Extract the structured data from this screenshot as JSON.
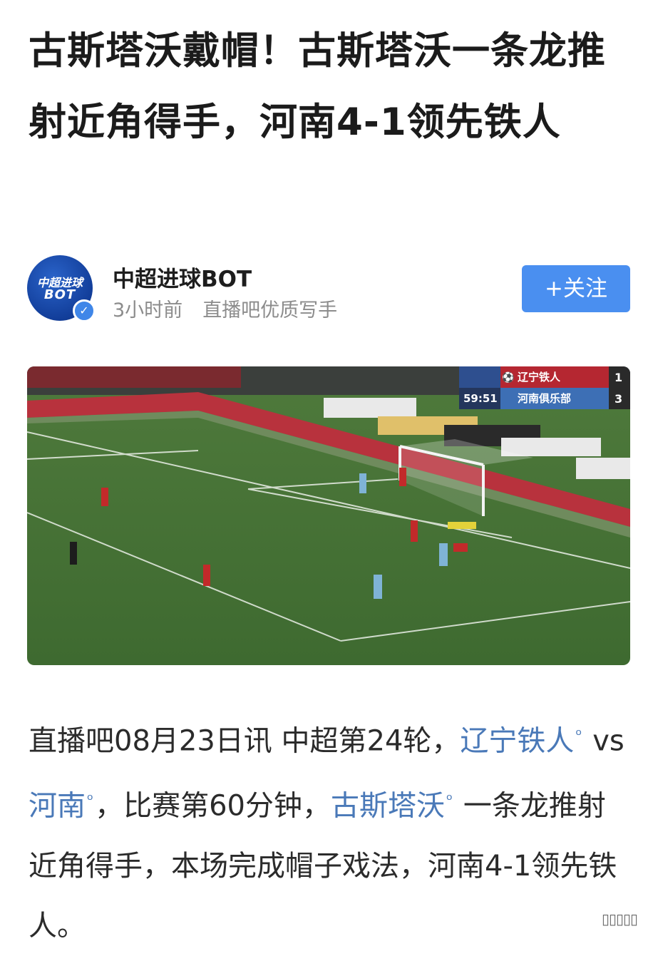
{
  "article": {
    "title": "古斯塔沃戴帽！古斯塔沃一条龙推射近角得手，河南4-1领先铁人"
  },
  "author": {
    "avatar_line1": "中超进球",
    "avatar_line2": "BOT",
    "name": "中超进球BOT",
    "time": "3小时前",
    "tag": "直播吧优质写手",
    "follow_label": "+关注"
  },
  "scoreboard": {
    "match_time": "59:51",
    "team1_name": "辽宁铁人",
    "team1_score": "1",
    "team2_name": "河南俱乐部",
    "team2_score": "3"
  },
  "body": {
    "p1": "直播吧08月23日讯 中超第24轮，",
    "link_team1": "辽宁铁人",
    "p2": " vs",
    "link_team2": "河南",
    "p3": "，比赛第60分钟，",
    "link_player": "古斯塔沃",
    "p4": " 一条龙推射近角得手，本场完成帽子戏法，河南4-1领先铁人。"
  },
  "icons": {
    "search": "search-icon",
    "verified": "verified-badge-icon"
  },
  "colors": {
    "follow_button": "#4a8ff0",
    "link": "#4a79b8",
    "avatar": "#123e9a"
  }
}
